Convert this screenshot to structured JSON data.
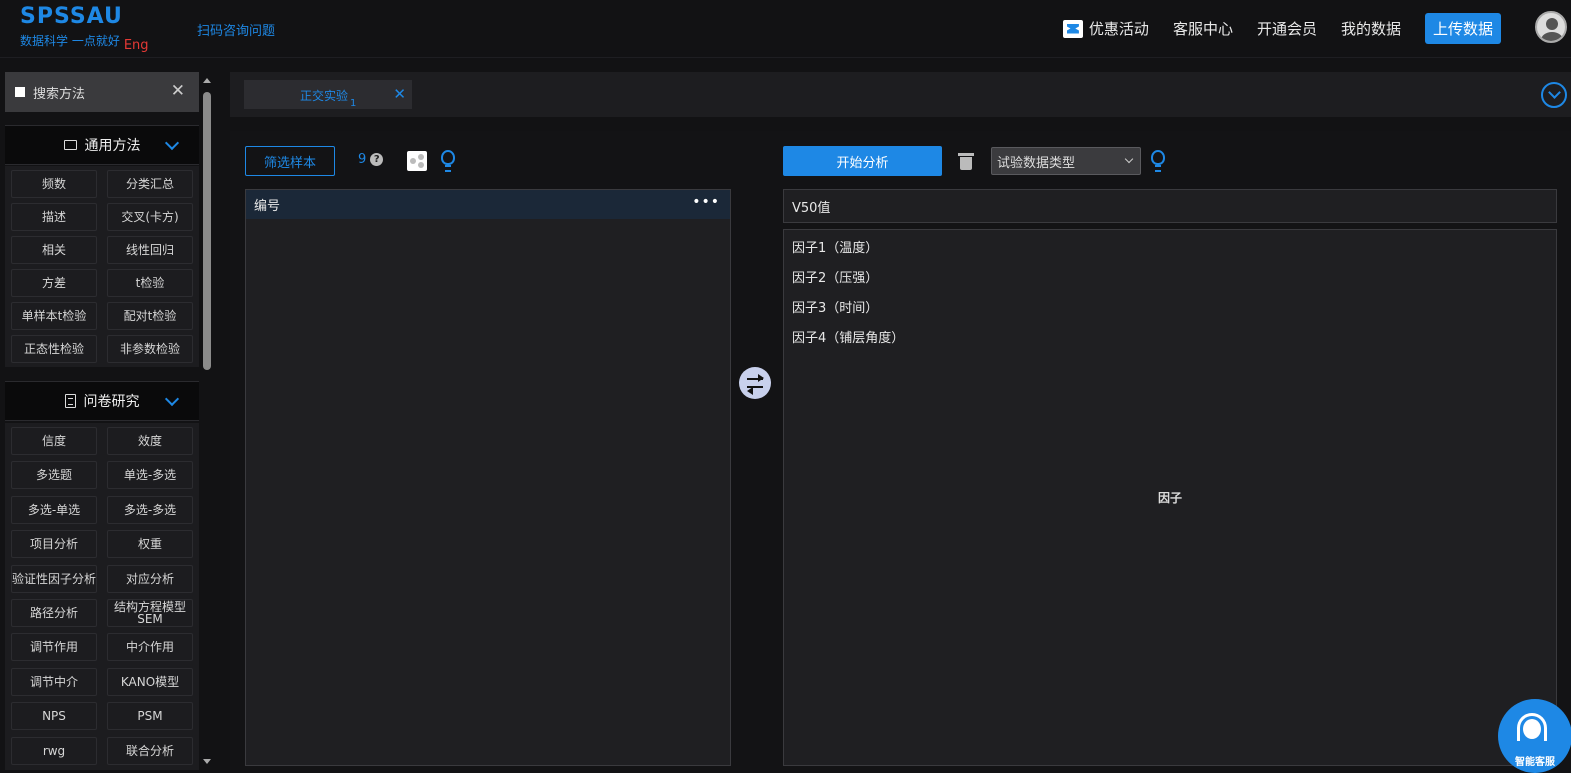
{
  "header": {
    "logo_main": "SPSSAU",
    "logo_tagline": "数据科学 一点就好",
    "logo_lang": "Eng",
    "scan_link": "扫码咨询问题",
    "nav": {
      "promo": "优惠活动",
      "service": "客服中心",
      "membership": "开通会员",
      "my_data": "我的数据",
      "upload": "上传数据"
    }
  },
  "sidebar": {
    "search_label": "搜索方法",
    "search_close": "✕",
    "general": {
      "title": "通用方法",
      "items": [
        "频数",
        "分类汇总",
        "描述",
        "交叉(卡方)",
        "相关",
        "线性回归",
        "方差",
        "t检验",
        "单样本t检验",
        "配对t检验",
        "正态性检验",
        "非参数检验"
      ]
    },
    "survey": {
      "title": "问卷研究",
      "items": [
        "信度",
        "效度",
        "多选题",
        "单选-多选",
        "多选-单选",
        "多选-多选",
        "项目分析",
        "权重",
        "验证性因子分析",
        "对应分析",
        "路径分析",
        "结构方程模型SEM",
        "调节作用",
        "中介作用",
        "调节中介",
        "KANO模型",
        "NPS",
        "PSM",
        "rwg",
        "联合分析"
      ]
    }
  },
  "tabs": [
    {
      "label": "正交实验",
      "num": "1",
      "close": "✕"
    }
  ],
  "toolbar": {
    "filter_btn": "筛选样本",
    "sample_count": "9",
    "help": "?",
    "start_btn": "开始分析",
    "data_type_select": "试验数据类型"
  },
  "variables": {
    "header": "编号",
    "more": "•••"
  },
  "dependent": {
    "value": "V50值"
  },
  "factors": {
    "items": [
      "因子1（温度）",
      "因子2（压强）",
      "因子3（时间）",
      "因子4（铺层角度）"
    ],
    "caption": "因子"
  },
  "support": {
    "label": "智能客服"
  },
  "colors": {
    "accent": "#1e88e5",
    "bg": "#121214",
    "panel": "#1f1f22",
    "danger": "#e53935"
  }
}
